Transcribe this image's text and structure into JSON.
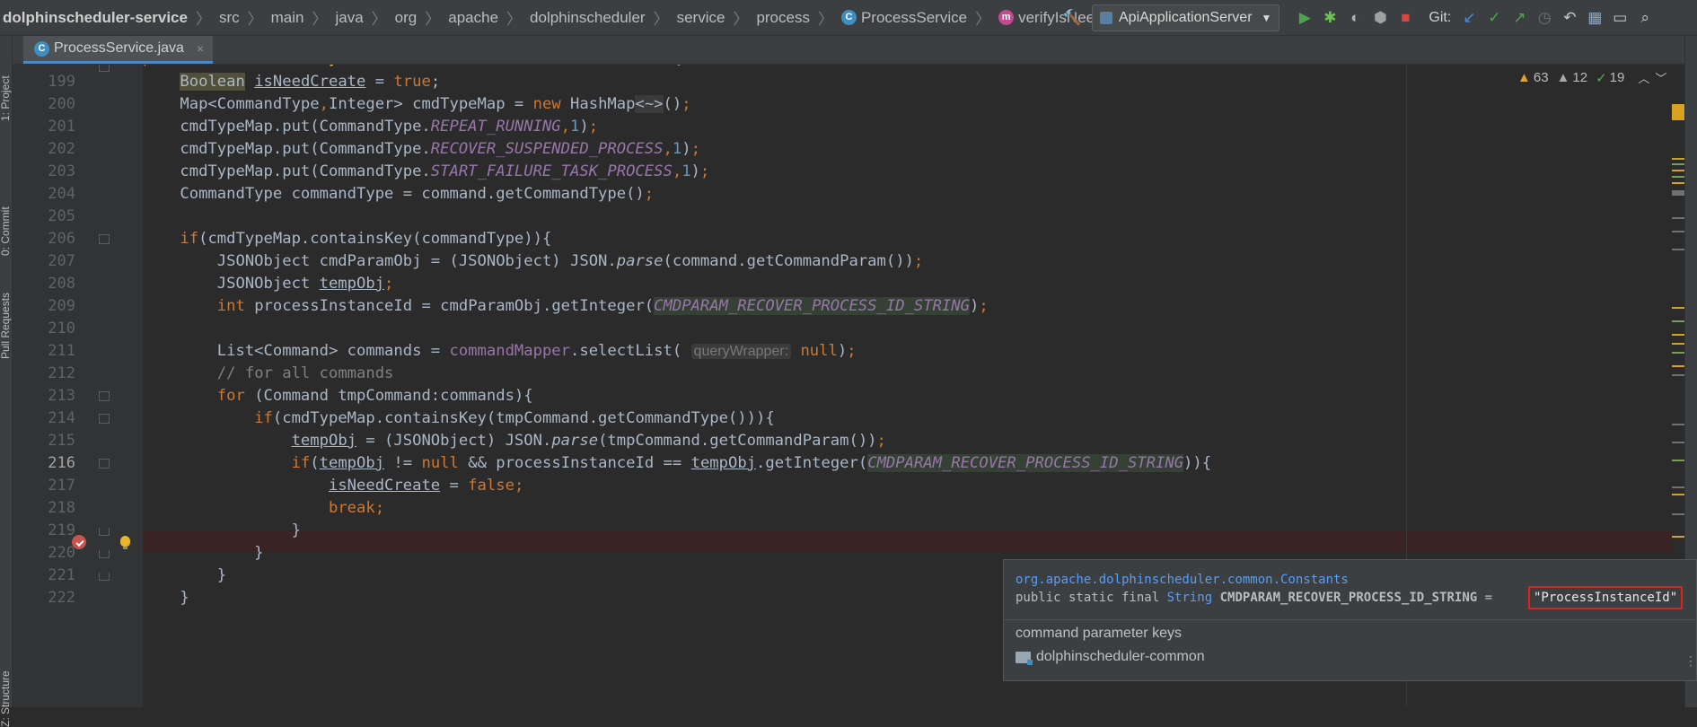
{
  "breadcrumbs": [
    "dolphinscheduler-service",
    "src",
    "main",
    "java",
    "org",
    "apache",
    "dolphinscheduler",
    "service",
    "process",
    "ProcessService",
    "verifyIsNeedCreateCommand"
  ],
  "toolbar": {
    "run_config": "ApiApplicationServer",
    "git_label": "Git:"
  },
  "side_panels": {
    "project": "1: Project",
    "commit": "0: Commit",
    "pull_requests": "Pull Requests",
    "structure": "Z: Structure"
  },
  "tab": {
    "label": "ProcessService.java",
    "close": "×"
  },
  "inspections": {
    "warnings": "63",
    "weak_warnings": "12",
    "typos": "19"
  },
  "code": {
    "lines": [
      {
        "no": "199",
        "text": "Boolean isNeedCreate = true;"
      },
      {
        "no": "200",
        "text": "Map<CommandType,Integer> cmdTypeMap = new HashMap<~>();"
      },
      {
        "no": "201",
        "text": "cmdTypeMap.put(CommandType.REPEAT_RUNNING,1);"
      },
      {
        "no": "202",
        "text": "cmdTypeMap.put(CommandType.RECOVER_SUSPENDED_PROCESS,1);"
      },
      {
        "no": "203",
        "text": "cmdTypeMap.put(CommandType.START_FAILURE_TASK_PROCESS,1);"
      },
      {
        "no": "204",
        "text": "CommandType commandType = command.getCommandType();"
      },
      {
        "no": "205",
        "text": ""
      },
      {
        "no": "206",
        "text": "if(cmdTypeMap.containsKey(commandType)){"
      },
      {
        "no": "207",
        "text": "JSONObject cmdParamObj = (JSONObject) JSON.parse(command.getCommandParam());"
      },
      {
        "no": "208",
        "text": "JSONObject tempObj;"
      },
      {
        "no": "209",
        "text": "int processInstanceId = cmdParamObj.getInteger(CMDPARAM_RECOVER_PROCESS_ID_STRING);"
      },
      {
        "no": "210",
        "text": ""
      },
      {
        "no": "211",
        "text": "List<Command> commands = commandMapper.selectList( queryWrapper: null);"
      },
      {
        "no": "212",
        "text": "// for all commands"
      },
      {
        "no": "213",
        "text": "for (Command tmpCommand:commands){"
      },
      {
        "no": "214",
        "text": "if(cmdTypeMap.containsKey(tmpCommand.getCommandType())){"
      },
      {
        "no": "215",
        "text": "tempObj = (JSONObject) JSON.parse(tmpCommand.getCommandParam());"
      },
      {
        "no": "216",
        "text": "if(tempObj != null && processInstanceId == tempObj.getInteger(CMDPARAM_RECOVER_PROCESS_ID_STRING)){"
      },
      {
        "no": "217",
        "text": "isNeedCreate = false;"
      },
      {
        "no": "218",
        "text": "break;"
      },
      {
        "no": "219",
        "text": "}"
      },
      {
        "no": "220",
        "text": "}"
      },
      {
        "no": "221",
        "text": "}"
      }
    ]
  },
  "doc_popup": {
    "package": "org.apache.dolphinscheduler.common.Constants",
    "modifiers": "public static final",
    "type": "String",
    "name": "CMDPARAM_RECOVER_PROCESS_ID_STRING",
    "equals": "=",
    "value": "\"ProcessInstanceId\"",
    "description": "command parameter keys",
    "module": "dolphinscheduler-common"
  },
  "colors": {
    "background": "#2b2b2b",
    "keyword": "#cc7832",
    "number": "#6897bb",
    "field": "#9876aa",
    "comment": "#808080",
    "breakpoint": "#c75450",
    "highlight_box": "#e0201a"
  }
}
